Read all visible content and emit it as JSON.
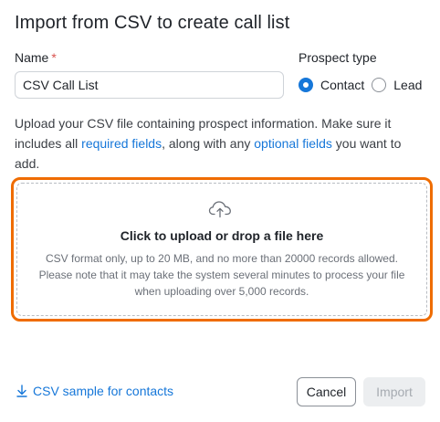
{
  "dialog": {
    "title": "Import from CSV to create call list"
  },
  "name_field": {
    "label": "Name",
    "required_mark": "*",
    "value": "CSV Call List"
  },
  "prospect_type": {
    "label": "Prospect type",
    "options": [
      {
        "label": "Contact",
        "checked": true
      },
      {
        "label": "Lead",
        "checked": false
      }
    ]
  },
  "description": {
    "text_1": "Upload your CSV file containing prospect information. Make sure it includes all ",
    "link_required": "required fields",
    "text_2": ", along with any ",
    "link_optional": "optional fields",
    "text_3": " you want to add."
  },
  "upload": {
    "icon": "cloud-upload-icon",
    "title": "Click to upload or drop a file here",
    "help": "CSV format only, up to 20 MB, and no more than 20000 records allowed. Please note that it may take the system several minutes to process your file when uploading over 5,000 records."
  },
  "footer": {
    "sample_link": "CSV sample for contacts",
    "cancel_label": "Cancel",
    "import_label": "Import"
  },
  "colors": {
    "accent": "#1677d9",
    "focus_ring": "#ef6c00",
    "required": "#d9534f"
  }
}
